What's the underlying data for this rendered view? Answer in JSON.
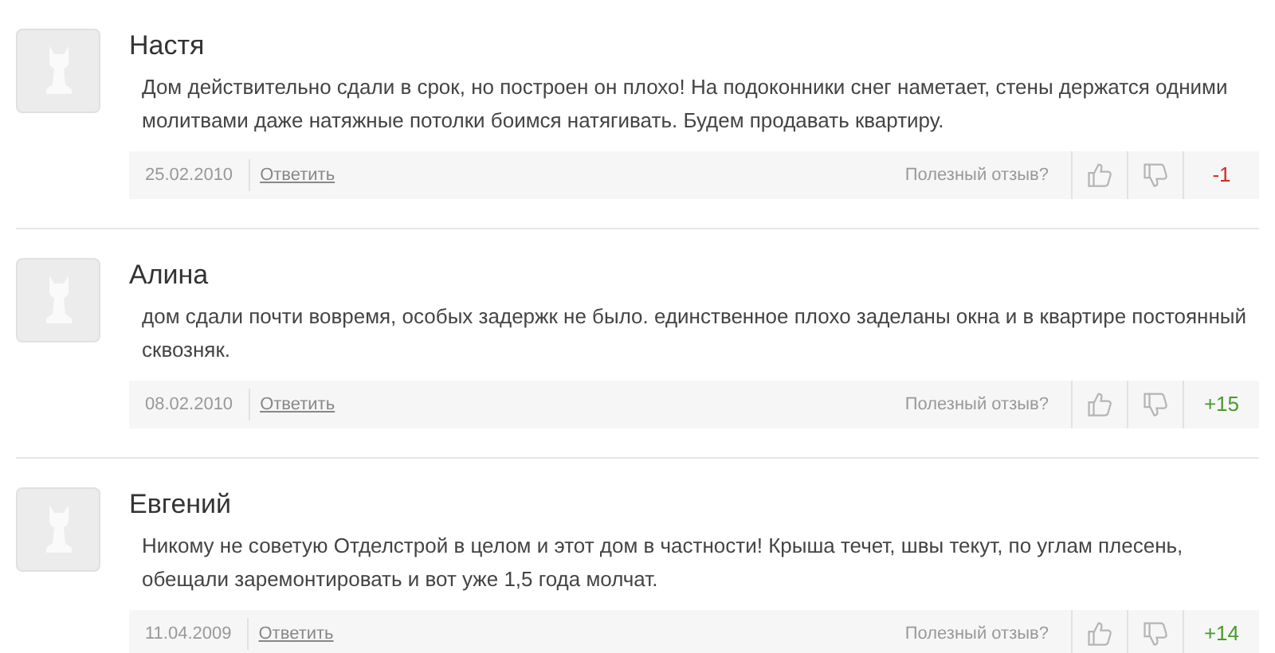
{
  "reviews": [
    {
      "author": "Настя",
      "text": "Дом действительно сдали в срок, но построен он плохо! На подоконники снег наметает, стены держатся одними\nмолитвами даже натяжные потолки боимся натягивать. Будем продавать квартиру.",
      "date": "25.02.2010",
      "reply": "Ответить",
      "helpful": "Полезный отзыв?",
      "score": "-1",
      "color": "#c9302c"
    },
    {
      "author": "Алина",
      "text": "дом сдали почти вовремя, особых задержк не было. единственное плохо заделаны окна и в квартире постоянный\nсквозняк.",
      "date": "08.02.2010",
      "reply": "Ответить",
      "helpful": "Полезный отзыв?",
      "score": "+15",
      "color": "#4a9a2c"
    },
    {
      "author": "Евгений",
      "text": "Никому не советую Отделстрой в целом и этот дом в частности! Крыша течет, швы текут, по углам плесень,\nобещали заремонтировать и вот уже 1,5 года молчат.",
      "date": "11.04.2009",
      "reply": "Ответить",
      "helpful": "Полезный отзыв?",
      "score": "+14",
      "color": "#4a9a2c"
    }
  ]
}
